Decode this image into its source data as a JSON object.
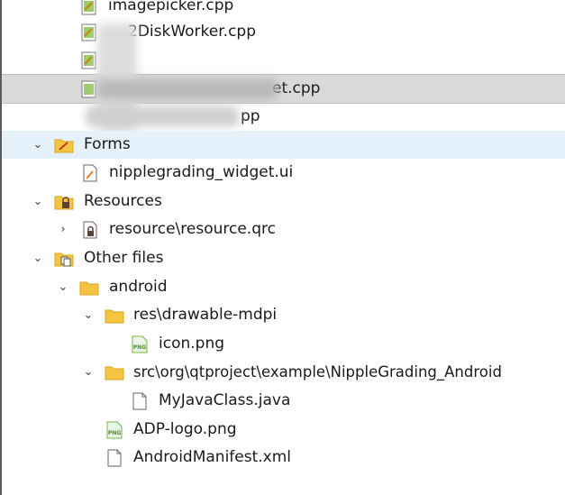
{
  "tree": {
    "items": [
      {
        "label": "imagepicker.cpp"
      },
      {
        "label": "2DiskWorker.cpp"
      },
      {
        "label": ""
      },
      {
        "label": "et.cpp"
      },
      {
        "label": "pp"
      },
      {
        "label": "Forms"
      },
      {
        "label": "nipplegrading_widget.ui"
      },
      {
        "label": "Resources"
      },
      {
        "label": "resource\\resource.qrc"
      },
      {
        "label": "Other files"
      },
      {
        "label": "android"
      },
      {
        "label": "res\\drawable-mdpi"
      },
      {
        "label": "icon.png"
      },
      {
        "label": "src\\org\\qtproject\\example\\NippleGrading_Android"
      },
      {
        "label": "MyJavaClass.java"
      },
      {
        "label": "ADP-logo.png"
      },
      {
        "label": "AndroidManifest.xml"
      }
    ],
    "png_badge": "PNG"
  },
  "colors": {
    "selection": "#e5f1fb",
    "folder": "#f5c542",
    "png_icon": "#7cb342"
  }
}
